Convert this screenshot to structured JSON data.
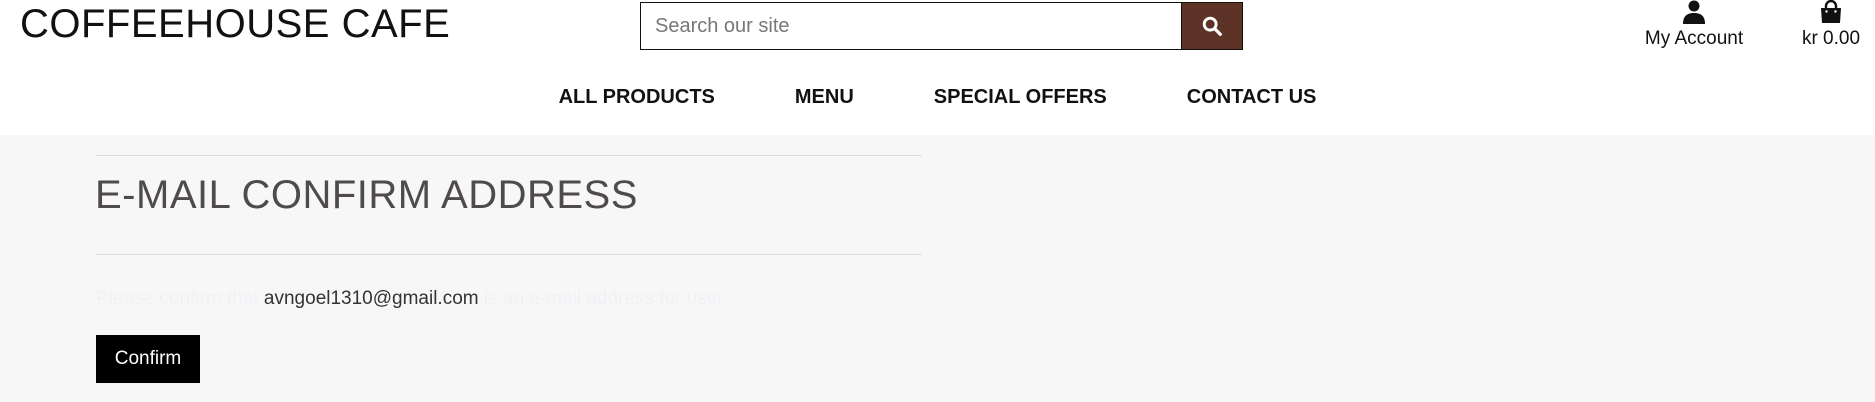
{
  "header": {
    "brand": "COFFEEHOUSE CAFE",
    "search": {
      "placeholder": "Search our site",
      "button_icon": "search-icon"
    },
    "account": {
      "label": "My Account",
      "icon": "user-icon"
    },
    "bag": {
      "label": "kr 0.00",
      "icon": "shopping-bag-icon"
    }
  },
  "nav": {
    "items": [
      {
        "label": "ALL PRODUCTS"
      },
      {
        "label": "MENU"
      },
      {
        "label": "SPECIAL OFFERS"
      },
      {
        "label": "CONTACT US"
      }
    ]
  },
  "main": {
    "title": "E-MAIL CONFIRM ADDRESS",
    "message": {
      "prefix": "Please confirm that",
      "email": "avngoel1310@gmail.com",
      "suffix": "is an e-mail address for user"
    },
    "confirm_label": "Confirm"
  },
  "colors": {
    "search_button": "#5c3326",
    "background_main": "#f8f7f8",
    "title_text": "#4f4b4b",
    "confirm_button": "#000000"
  }
}
